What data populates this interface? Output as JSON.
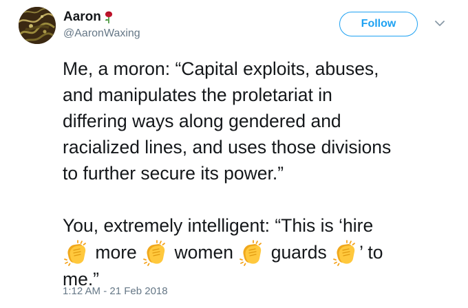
{
  "user": {
    "name": "Aaron",
    "name_icon": "rose-icon",
    "handle": "@AaronWaxing",
    "avatar_icon": "avatar-image"
  },
  "follow_button": {
    "label": "Follow"
  },
  "menu_icon": "chevron-down-icon",
  "tweet": {
    "line1": "Me, a moron: “Capital exploits, abuses,",
    "line2": "and manipulates the proletariat in",
    "line3": "differing ways along gendered and",
    "line4": "racialized lines, and uses those divisions",
    "line5": "to further secure its power.”",
    "line6": "You, extremely intelligent: “This is ‘hire",
    "line7_word1": "more",
    "line7_word2": "women",
    "line7_word3": "guards",
    "line7_word4": "’ to",
    "line8": "me.”",
    "emoji": "clapping-hands-icon"
  },
  "timestamp": "1:12 AM - 21 Feb 2018",
  "colors": {
    "accent": "#1da1f2",
    "text": "#14171a",
    "secondary": "#657786",
    "rose": "#c0142c",
    "clap": "#ffc83d"
  }
}
